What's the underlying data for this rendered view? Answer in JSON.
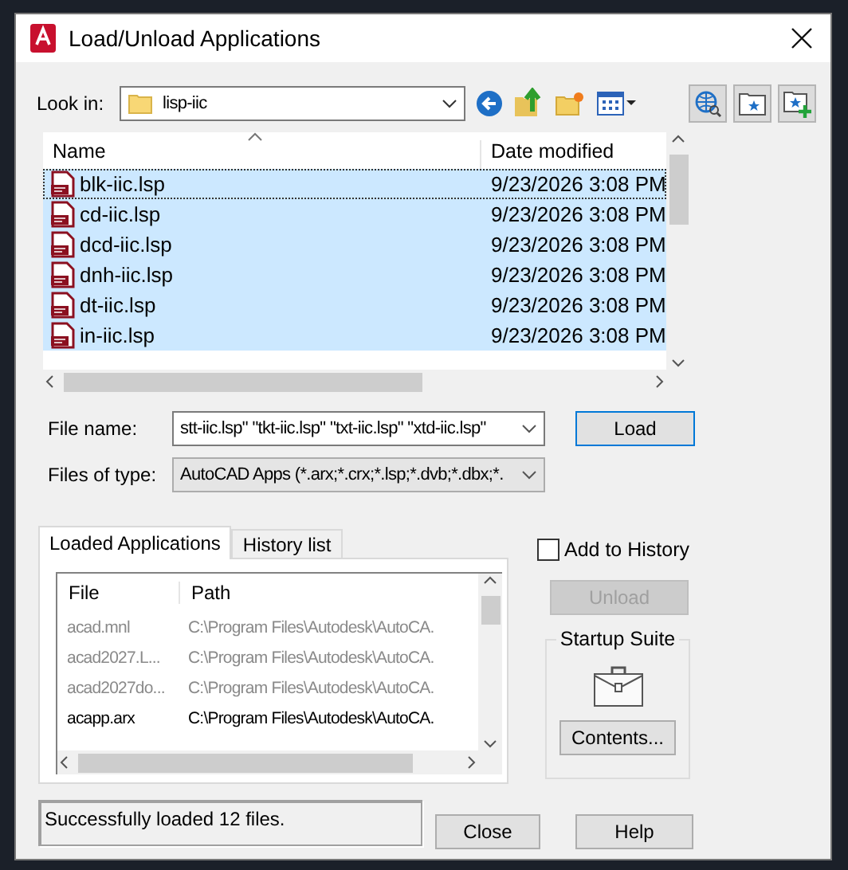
{
  "window": {
    "title": "Load/Unload Applications"
  },
  "look_in": {
    "label": "Look in:",
    "value": "lisp-iic"
  },
  "file_list": {
    "columns": [
      "Name",
      "Date modified"
    ],
    "rows": [
      {
        "name": "blk-iic.lsp",
        "date": "9/23/2026 3:08 PM",
        "selected": true,
        "focused": true
      },
      {
        "name": "cd-iic.lsp",
        "date": "9/23/2026 3:08 PM",
        "selected": true,
        "focused": false
      },
      {
        "name": "dcd-iic.lsp",
        "date": "9/23/2026 3:08 PM",
        "selected": true,
        "focused": false
      },
      {
        "name": "dnh-iic.lsp",
        "date": "9/23/2026 3:08 PM",
        "selected": true,
        "focused": false
      },
      {
        "name": "dt-iic.lsp",
        "date": "9/23/2026 3:08 PM",
        "selected": true,
        "focused": false
      },
      {
        "name": "in-iic.lsp",
        "date": "9/23/2026 3:08 PM",
        "selected": true,
        "focused": false
      }
    ]
  },
  "file_name": {
    "label": "File name:",
    "value": "stt-iic.lsp\" \"tkt-iic.lsp\" \"txt-iic.lsp\" \"xtd-iic.lsp\""
  },
  "file_type": {
    "label": "Files of type:",
    "value": "AutoCAD Apps (*.arx;*.crx;*.lsp;*.dvb;*.dbx;*."
  },
  "load_button": "Load",
  "tabs": [
    {
      "label": "Loaded Applications",
      "selected": true
    },
    {
      "label": "History list",
      "selected": false
    }
  ],
  "loaded_list": {
    "columns": [
      "File",
      "Path"
    ],
    "rows": [
      {
        "file": "acad.mnl",
        "path": "C:\\Program Files\\Autodesk\\AutoCA.",
        "disabled": true
      },
      {
        "file": "acad2027.L...",
        "path": "C:\\Program Files\\Autodesk\\AutoCA.",
        "disabled": true
      },
      {
        "file": "acad2027do...",
        "path": "C:\\Program Files\\Autodesk\\AutoCA.",
        "disabled": true
      },
      {
        "file": "acapp.arx",
        "path": "C:\\Program Files\\Autodesk\\AutoCA.",
        "disabled": false
      }
    ]
  },
  "add_to_history": {
    "label": "Add to History",
    "checked": false
  },
  "unload_button": {
    "label": "Unload",
    "disabled": true
  },
  "startup_suite": {
    "title": "Startup Suite",
    "button": "Contents..."
  },
  "status": "Successfully loaded 12 files.",
  "buttons": [
    "Close",
    "Help"
  ]
}
